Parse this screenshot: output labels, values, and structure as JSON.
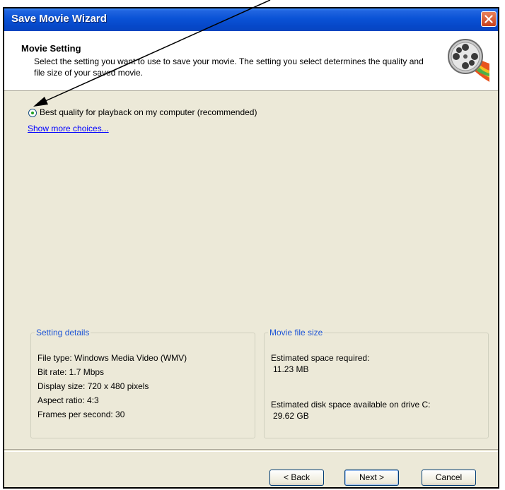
{
  "window": {
    "title": "Save Movie Wizard"
  },
  "header": {
    "title": "Movie Setting",
    "description": "Select the setting you want to use to save your movie. The setting you select determines the quality and file size of your saved movie."
  },
  "options": {
    "selected_label": "Best quality for playback on my computer (recommended)",
    "more_choices_link": "Show more choices..."
  },
  "setting_details": {
    "legend": "Setting details",
    "lines": [
      "File type: Windows Media Video (WMV)",
      "Bit rate: 1.7 Mbps",
      "Display size: 720 x 480 pixels",
      "Aspect ratio: 4:3",
      "Frames per second: 30"
    ]
  },
  "movie_file_size": {
    "legend": "Movie file size",
    "estimated_label": "Estimated space required:",
    "estimated_value": "11.23 MB",
    "disk_label": "Estimated disk space available on drive C:",
    "disk_value": "29.62 GB"
  },
  "buttons": {
    "back": "< Back",
    "next": "Next >",
    "cancel": "Cancel"
  },
  "colors": {
    "titlebar": "#0a52d6",
    "dialog_background": "#ece9d8",
    "legend_text": "#1f56d6",
    "link": "#0000ff",
    "close_button": "#d9552e"
  },
  "icons": {
    "close": "close-icon",
    "film_reel": "film-reel-icon",
    "annotation_arrow": "annotation-arrow"
  }
}
